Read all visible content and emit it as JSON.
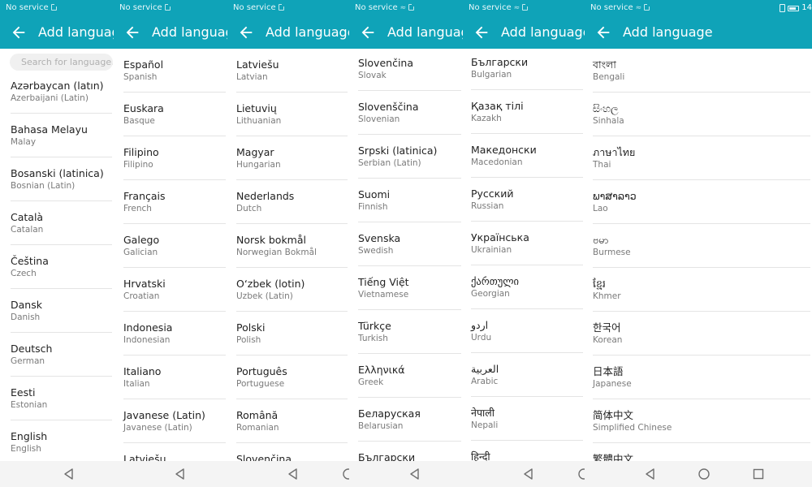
{
  "status": {
    "carrier": "No service",
    "time": "14"
  },
  "appbar": {
    "title": "Add language"
  },
  "search": {
    "placeholder": "Search for language..."
  },
  "columns": [
    {
      "items": [
        {
          "native": "Azərbaycan (latın)",
          "english": "Azerbaijani (Latin)"
        },
        {
          "native": "Bahasa Melayu",
          "english": "Malay"
        },
        {
          "native": "Bosanski (latinica)",
          "english": "Bosnian (Latin)"
        },
        {
          "native": "Català",
          "english": "Catalan"
        },
        {
          "native": "Čeština",
          "english": "Czech"
        },
        {
          "native": "Dansk",
          "english": "Danish"
        },
        {
          "native": "Deutsch",
          "english": "German"
        },
        {
          "native": "Eesti",
          "english": "Estonian"
        },
        {
          "native": "English",
          "english": "English"
        }
      ]
    },
    {
      "items": [
        {
          "native": "Español",
          "english": "Spanish"
        },
        {
          "native": "Euskara",
          "english": "Basque"
        },
        {
          "native": "Filipino",
          "english": "Filipino"
        },
        {
          "native": "Français",
          "english": "French"
        },
        {
          "native": "Galego",
          "english": "Galician"
        },
        {
          "native": "Hrvatski",
          "english": "Croatian"
        },
        {
          "native": "Indonesia",
          "english": "Indonesian"
        },
        {
          "native": "Italiano",
          "english": "Italian"
        },
        {
          "native": "Javanese (Latin)",
          "english": "Javanese (Latin)"
        },
        {
          "native": "Latviešu",
          "english": ""
        }
      ]
    },
    {
      "items": [
        {
          "native": "Latviešu",
          "english": "Latvian"
        },
        {
          "native": "Lietuvių",
          "english": "Lithuanian"
        },
        {
          "native": "Magyar",
          "english": "Hungarian"
        },
        {
          "native": "Nederlands",
          "english": "Dutch"
        },
        {
          "native": "Norsk bokmål",
          "english": "Norwegian Bokmål"
        },
        {
          "native": "O‘zbek (lotin)",
          "english": "Uzbek (Latin)"
        },
        {
          "native": "Polski",
          "english": "Polish"
        },
        {
          "native": "Português",
          "english": "Portuguese"
        },
        {
          "native": "Română",
          "english": "Romanian"
        },
        {
          "native": "Slovenčina",
          "english": ""
        }
      ]
    },
    {
      "items": [
        {
          "native": "Slovenčina",
          "english": "Slovak"
        },
        {
          "native": "Slovenščina",
          "english": "Slovenian"
        },
        {
          "native": "Srpski (latinica)",
          "english": "Serbian (Latin)"
        },
        {
          "native": "Suomi",
          "english": "Finnish"
        },
        {
          "native": "Svenska",
          "english": "Swedish"
        },
        {
          "native": "Tiếng Việt",
          "english": "Vietnamese"
        },
        {
          "native": "Türkçe",
          "english": "Turkish"
        },
        {
          "native": "Ελληνικά",
          "english": "Greek"
        },
        {
          "native": "Беларуская",
          "english": "Belarusian"
        },
        {
          "native": "Български",
          "english": ""
        }
      ]
    },
    {
      "items": [
        {
          "native": "Български",
          "english": "Bulgarian"
        },
        {
          "native": "Қазақ тілі",
          "english": "Kazakh"
        },
        {
          "native": "Македонски",
          "english": "Macedonian"
        },
        {
          "native": "Русский",
          "english": "Russian"
        },
        {
          "native": "Українська",
          "english": "Ukrainian"
        },
        {
          "native": "ქართული",
          "english": "Georgian"
        },
        {
          "native": "اردو",
          "english": "Urdu"
        },
        {
          "native": "العربية",
          "english": "Arabic"
        },
        {
          "native": "नेपाली",
          "english": "Nepali"
        },
        {
          "native": "हिन्दी",
          "english": ""
        }
      ]
    },
    {
      "items": [
        {
          "native": "বাংলা",
          "english": "Bengali"
        },
        {
          "native": "සිංහල",
          "english": "Sinhala"
        },
        {
          "native": "ภาษาไทย",
          "english": "Thai"
        },
        {
          "native": "ພາສາລາວ",
          "english": "Lao"
        },
        {
          "native": "ဗမာ",
          "english": "Burmese"
        },
        {
          "native": "ខ្មែរ",
          "english": "Khmer"
        },
        {
          "native": "한국어",
          "english": "Korean"
        },
        {
          "native": "日本語",
          "english": "Japanese"
        },
        {
          "native": "简体中文",
          "english": "Simplified Chinese"
        },
        {
          "native": "繁體中文",
          "english": ""
        }
      ]
    }
  ],
  "navbar": {
    "buttons": [
      "back-icon",
      "home-icon",
      "recents-icon"
    ]
  },
  "colors": {
    "accent": "#0fa3b8",
    "divider": "#e4e4e4",
    "navbar": "#f4f4f4"
  }
}
